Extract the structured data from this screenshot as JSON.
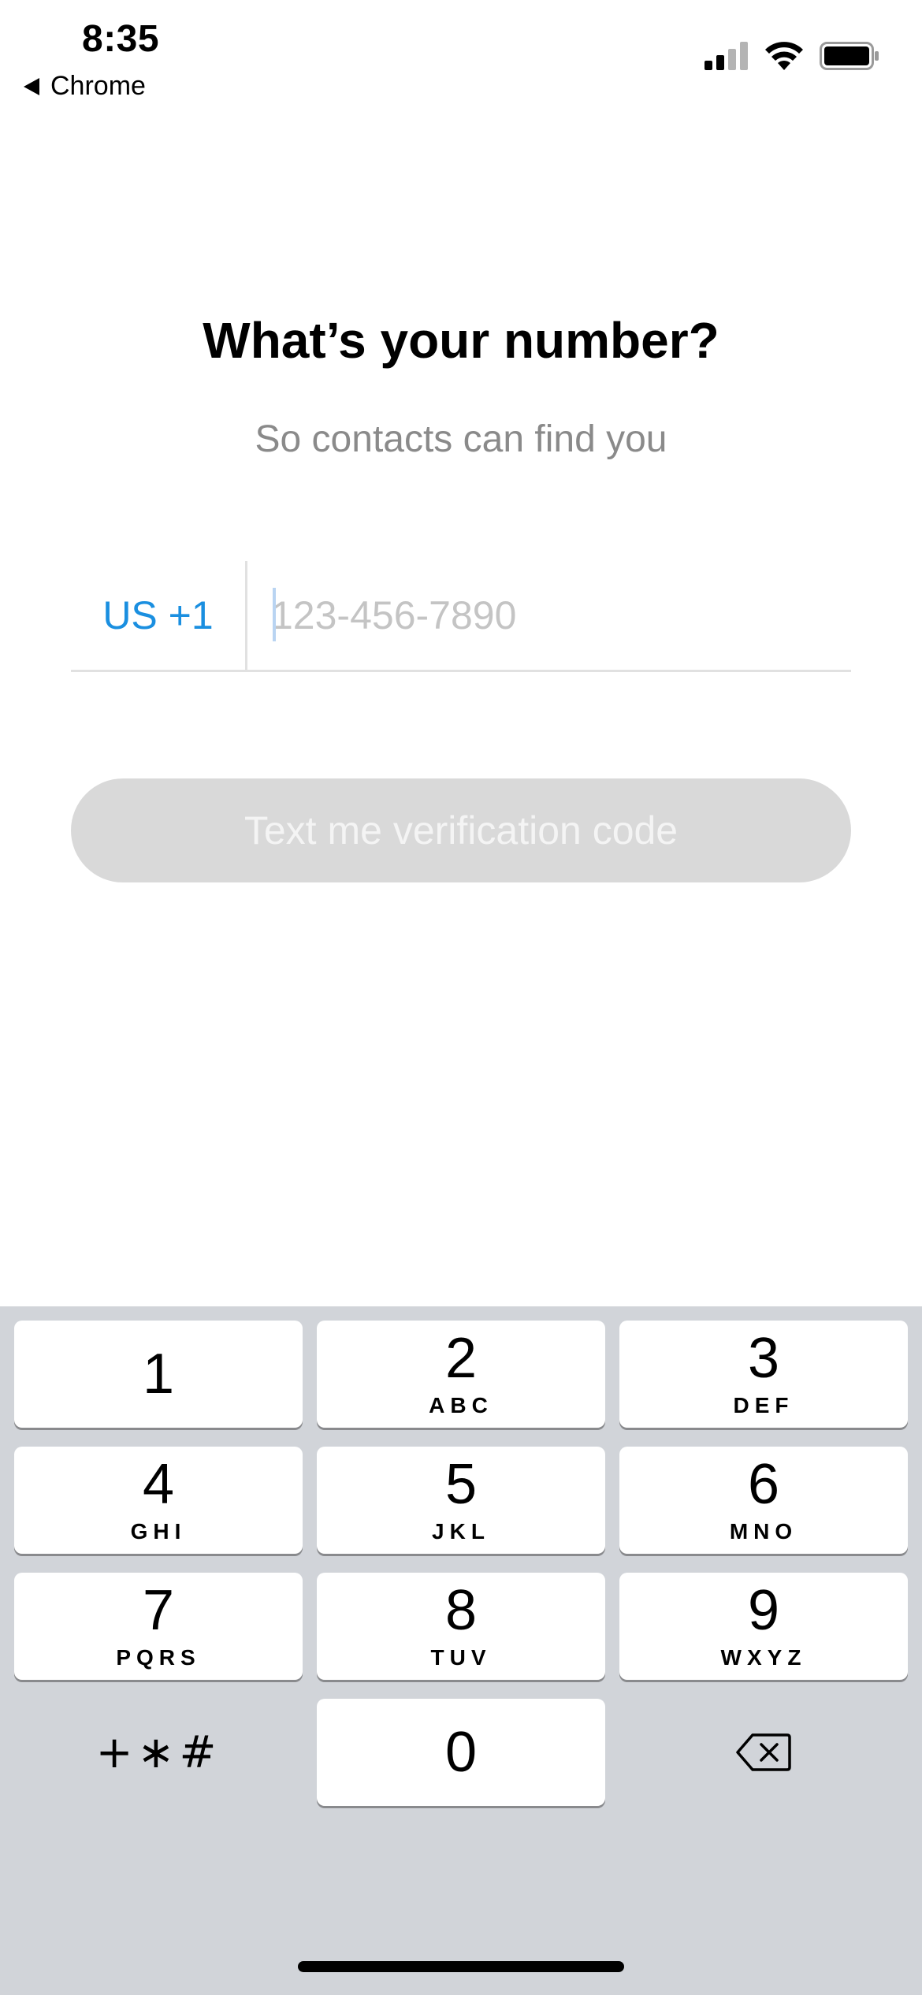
{
  "status_bar": {
    "time": "8:35",
    "back_label": "Chrome",
    "icons": [
      "cellular-signal-icon",
      "wifi-icon",
      "battery-icon"
    ]
  },
  "header": {
    "title": "What’s your number?",
    "subtitle": "So contacts can find you"
  },
  "phone": {
    "country_code": "US +1",
    "placeholder": "123-456-7890",
    "value": ""
  },
  "submit": {
    "label": "Text me verification code",
    "enabled": false
  },
  "keypad": {
    "keys": [
      {
        "digit": "1",
        "letters": ""
      },
      {
        "digit": "2",
        "letters": "ABC"
      },
      {
        "digit": "3",
        "letters": "DEF"
      },
      {
        "digit": "4",
        "letters": "GHI"
      },
      {
        "digit": "5",
        "letters": "JKL"
      },
      {
        "digit": "6",
        "letters": "MNO"
      },
      {
        "digit": "7",
        "letters": "PQRS"
      },
      {
        "digit": "8",
        "letters": "TUV"
      },
      {
        "digit": "9",
        "letters": "WXYZ"
      },
      {
        "digit": "0",
        "letters": ""
      }
    ],
    "symbols_label": "+∗#",
    "delete_icon": "backspace-icon"
  },
  "colors": {
    "accent": "#1a8fe0",
    "button_disabled": "#d9d9d9",
    "keypad_bg": "#d1d4d9",
    "placeholder": "#c4c4c4",
    "subtitle": "#8a8a8a"
  }
}
